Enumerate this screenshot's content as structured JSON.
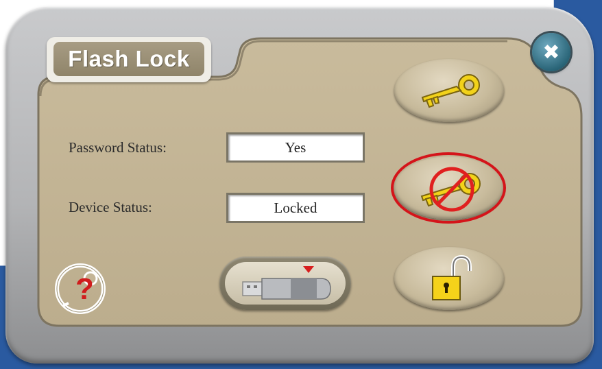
{
  "window": {
    "title": "Flash Lock",
    "close_symbol": "✖"
  },
  "fields": {
    "password_status_label": "Password Status:",
    "password_status_value": "Yes",
    "device_status_label": "Device Status:",
    "device_status_value": "Locked"
  },
  "buttons": {
    "set_password_icon": "key-icon",
    "remove_password_icon": "no-key-icon",
    "unlock_icon": "padlock-open-icon",
    "help_icon": "help-icon",
    "usb_icon": "usb-drive-icon"
  },
  "colors": {
    "panel": "#c4b596",
    "title_plaque": "#958a70",
    "key_gold": "#f2d21a",
    "highlight_red": "#d4141a",
    "close_teal": "#2a6578"
  }
}
